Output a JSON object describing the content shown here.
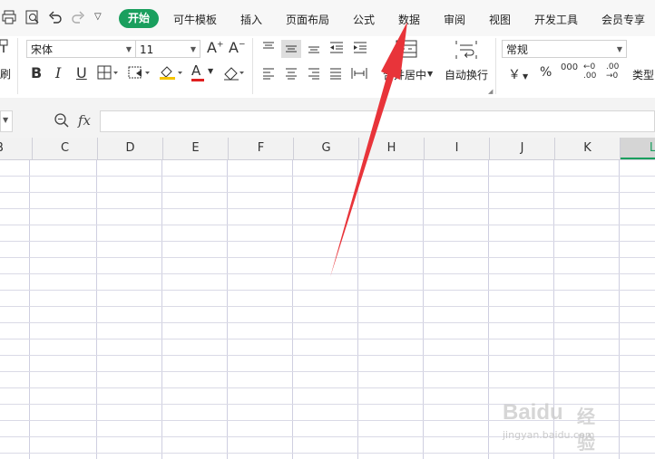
{
  "menubar": {
    "tabs": [
      {
        "label": "开始",
        "active": true
      },
      {
        "label": "可牛模板"
      },
      {
        "label": "插入"
      },
      {
        "label": "页面布局"
      },
      {
        "label": "公式"
      },
      {
        "label": "数据"
      },
      {
        "label": "审阅"
      },
      {
        "label": "视图"
      },
      {
        "label": "开发工具"
      },
      {
        "label": "会员专享"
      }
    ],
    "accent_color": "#1a9f5e"
  },
  "ribbon": {
    "font_name": "宋体",
    "font_size": "11",
    "merge_center_label": "合并居中",
    "wrap_text_label": "自动换行",
    "number_format": "常规",
    "currency_symbol": "￥",
    "percent_symbol": "%",
    "thousands_symbol": "000",
    "increase_decimal": "←0\n.00",
    "decrease_decimal": ".00\n→0",
    "type_convert_label": "类型",
    "brush_label": "刷",
    "bold": "B",
    "italic": "I",
    "underline": "U",
    "font_color_letter": "A",
    "font_grow": "A⁺",
    "font_shrink": "A⁻"
  },
  "formula_bar": {
    "fx_label": "fx",
    "value": ""
  },
  "grid": {
    "columns": [
      "B",
      "C",
      "D",
      "E",
      "F",
      "G",
      "H",
      "I",
      "J",
      "K",
      "L"
    ],
    "selected_column": "L"
  },
  "annotation": {
    "arrow_color": "#e8343a"
  },
  "watermark": {
    "brand": "Baidu",
    "brand_cn": "经验",
    "url": "jingyan.baidu.com"
  }
}
